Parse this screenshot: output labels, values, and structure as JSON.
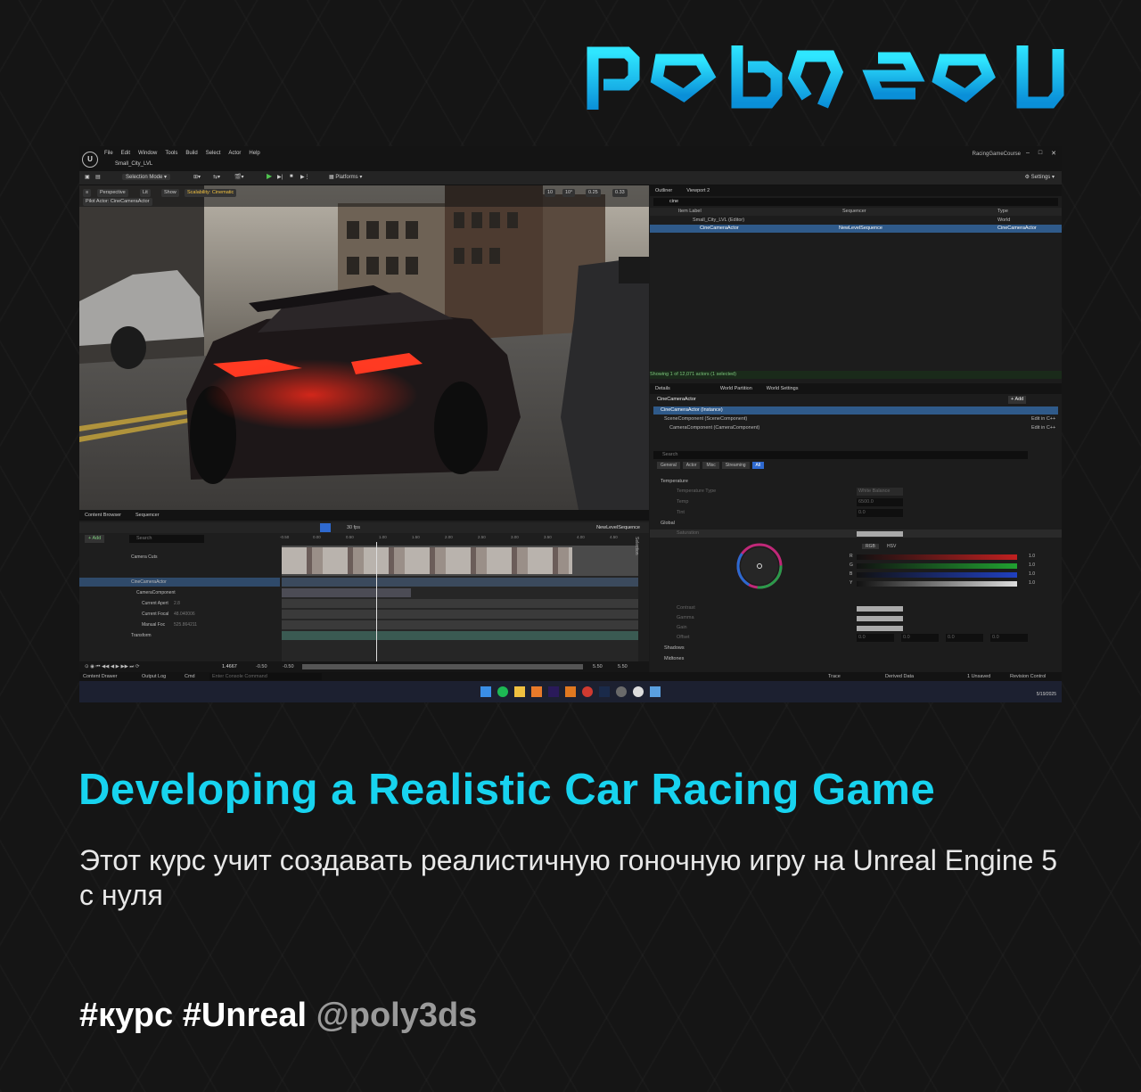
{
  "brand": {
    "logo_alt": "poly3ds",
    "accent": "#17d3ef"
  },
  "editor": {
    "menu": [
      "File",
      "Edit",
      "Window",
      "Tools",
      "Build",
      "Select",
      "Actor",
      "Help"
    ],
    "level_name": "Small_City_LVL",
    "project_name": "RacingGameCourse",
    "toolbar": {
      "mode": "Selection Mode",
      "platforms": "Platforms",
      "settings": "Settings"
    },
    "viewport": {
      "perspective": "Perspective",
      "lit": "Lit",
      "show": "Show",
      "scalability": "Scalability: Cinematic",
      "pilot": "Pilot Actor: CineCameraActor",
      "snap_grid": "10",
      "snap_angle": "10°",
      "snap_scale": "0.25",
      "speed": "0.33"
    },
    "outliner": {
      "tabs": [
        "Outliner",
        "Viewport 2"
      ],
      "search": "cine",
      "columns": [
        "Item Label",
        "Sequencer",
        "Type"
      ],
      "rows": [
        {
          "label": "Small_City_LVL (Editor)",
          "seq": "",
          "type": "World"
        },
        {
          "label": "CineCameraActor",
          "seq": "NewLevelSequence",
          "type": "CineCameraActor"
        }
      ],
      "status": "Showing 1 of 12,071 actors (1 selected)"
    },
    "details": {
      "tabs": [
        "Details",
        "World Partition",
        "World Settings"
      ],
      "actor": "CineCameraActor",
      "add": "Add",
      "instance": "CineCameraActor (Instance)",
      "components": [
        {
          "name": "SceneComponent (SceneComponent)",
          "link": "Edit in C++"
        },
        {
          "name": "CameraComponent (CameraComponent)",
          "link": "Edit in C++"
        }
      ],
      "search_placeholder": "Search",
      "filters": [
        "General",
        "Actor",
        "Misc",
        "Streaming",
        "All"
      ],
      "sections": [
        "Temperature",
        "Global",
        "Saturation",
        "Contrast",
        "Gamma",
        "Gain",
        "Offset",
        "Shadows",
        "Midtones"
      ],
      "props": {
        "temp_type": "Temperature Type",
        "temp_type_val": "White Balance",
        "temp": "Temp",
        "temp_val": "6500.0",
        "tint": "Tint",
        "tint_val": "0.0"
      },
      "color": {
        "rgb": "RGB",
        "hsv": "HSV",
        "channels": [
          "R",
          "G",
          "B",
          "Y"
        ],
        "value": "1.0"
      },
      "offset": {
        "r": "0.0",
        "g": "0.0",
        "b": "0.0",
        "y": "0.0"
      }
    },
    "sequencer": {
      "tabs": [
        "Content Browser",
        "Sequencer"
      ],
      "fps": "30 fps",
      "sequence_name": "NewLevelSequence",
      "add": "Add",
      "search_placeholder": "Search",
      "time_current": "1.4667",
      "ticks": [
        "-0.50",
        "0.00",
        "0.50",
        "1.00",
        "1.50",
        "2.00",
        "2.50",
        "3.00",
        "3.50",
        "4.00",
        "4.50"
      ],
      "tracks": [
        {
          "name": "Camera Cuts",
          "value": ""
        },
        {
          "name": "CineCameraActor",
          "value": ""
        },
        {
          "name": "CameraComponent",
          "value": ""
        },
        {
          "name": "Current Apert",
          "value": "2.8"
        },
        {
          "name": "Current Focal",
          "value": "48.040006"
        },
        {
          "name": "Manual Foc",
          "value": "525.864211"
        },
        {
          "name": "Transform",
          "value": ""
        }
      ],
      "bottom": {
        "start": "-0.50",
        "start2": "-0.50",
        "end": "5.50",
        "end2": "5.50"
      },
      "side_label": "Selection"
    },
    "statusbar": {
      "content_drawer": "Content Drawer",
      "output_log": "Output Log",
      "cmd": "Cmd",
      "cmd_placeholder": "Enter Console Command",
      "trace": "Trace",
      "derived": "Derived Data",
      "unsaved": "1 Unsaved",
      "revision": "Revision Control"
    },
    "taskbar": {
      "date": "5/19/2025"
    }
  },
  "headline": "Developing a Realistic Car Racing Game",
  "description": "Этот курс учит создавать реалистичную гоночную игру на Unreal Engine 5 с нуля",
  "tags": {
    "tag1": "#курс",
    "tag2": "#Unreal",
    "handle": "@poly3ds"
  }
}
